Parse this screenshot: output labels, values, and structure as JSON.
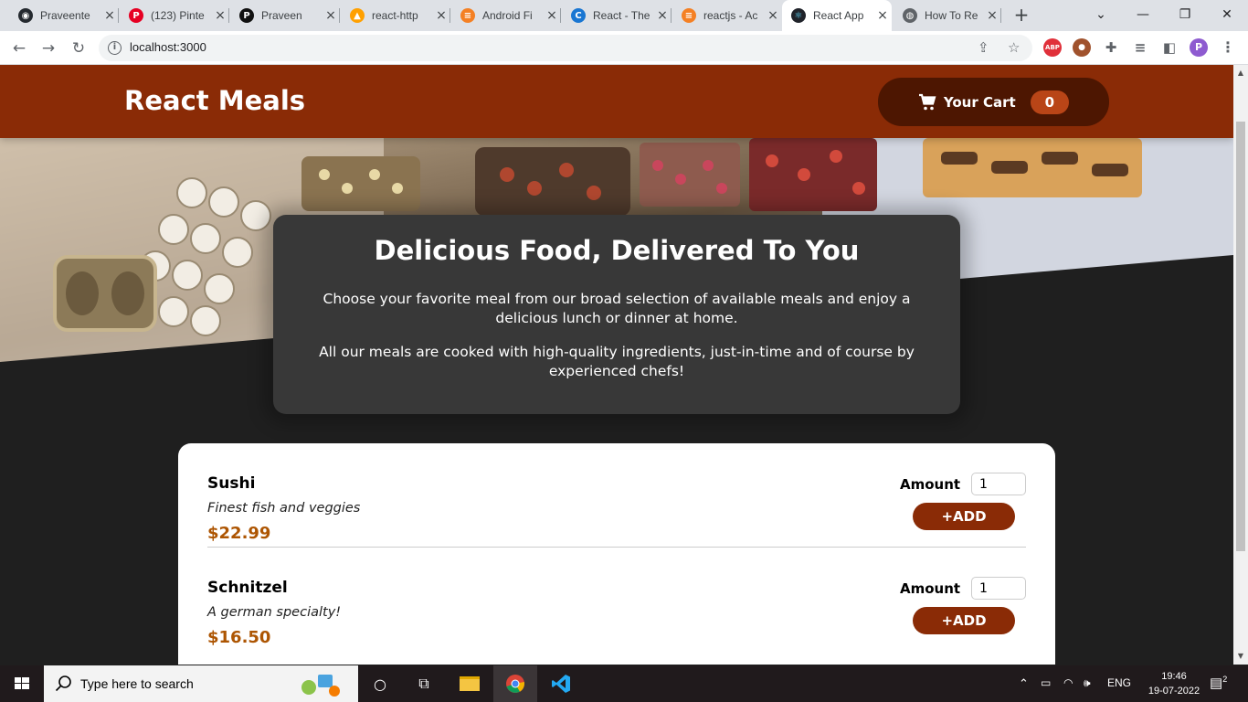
{
  "browser": {
    "tabs": [
      {
        "title": "Praveente",
        "icon": "github-icon",
        "color": "#24292f",
        "glyph": "◉"
      },
      {
        "title": "(123) Pinte",
        "icon": "pinterest-icon",
        "color": "#e60023",
        "glyph": "P"
      },
      {
        "title": "Praveen",
        "icon": "medium-icon",
        "color": "#111111",
        "glyph": "P"
      },
      {
        "title": "react-http",
        "icon": "firebase-icon",
        "color": "#ffa000",
        "glyph": "▲"
      },
      {
        "title": "Android Fi",
        "icon": "stackoverflow-icon",
        "color": "#f48024",
        "glyph": "≡"
      },
      {
        "title": "React - The",
        "icon": "react-docs-icon",
        "color": "#1976d2",
        "glyph": "C"
      },
      {
        "title": "reactjs - Ac",
        "icon": "stackoverflow-icon",
        "color": "#f48024",
        "glyph": "≡"
      },
      {
        "title": "React App",
        "icon": "react-icon",
        "color": "#20232a",
        "glyph": "⚛",
        "active": true
      },
      {
        "title": "How To Re",
        "icon": "globe-icon",
        "color": "#5f6368",
        "glyph": "◍"
      }
    ],
    "url": "localhost:3000",
    "profile_initial": "P",
    "abp_label": "ABP"
  },
  "page": {
    "brand": "React Meals",
    "cart": {
      "label": "Your Cart",
      "count": "0"
    },
    "summary": {
      "title": "Delicious Food, Delivered To You",
      "p1": "Choose your favorite meal from our broad selection of available meals and enjoy a delicious lunch or dinner at home.",
      "p2": "All our meals are cooked with high-quality ingredients, just-in-time and of course by experienced chefs!"
    },
    "amount_label": "Amount",
    "add_label": "+ADD",
    "meals": [
      {
        "name": "Sushi",
        "description": "Finest fish and veggies",
        "price": "$22.99",
        "amount": "1"
      },
      {
        "name": "Schnitzel",
        "description": "A german specialty!",
        "price": "$16.50",
        "amount": "1"
      }
    ]
  },
  "taskbar": {
    "search_placeholder": "Type here to search",
    "language": "ENG",
    "time": "19:46",
    "date": "19-07-2022",
    "notification_count": "2"
  },
  "colors": {
    "header": "#8a2b06",
    "cart_button": "#4d1601",
    "badge": "#b94517",
    "price": "#ad5502",
    "page_bg": "#383838"
  }
}
